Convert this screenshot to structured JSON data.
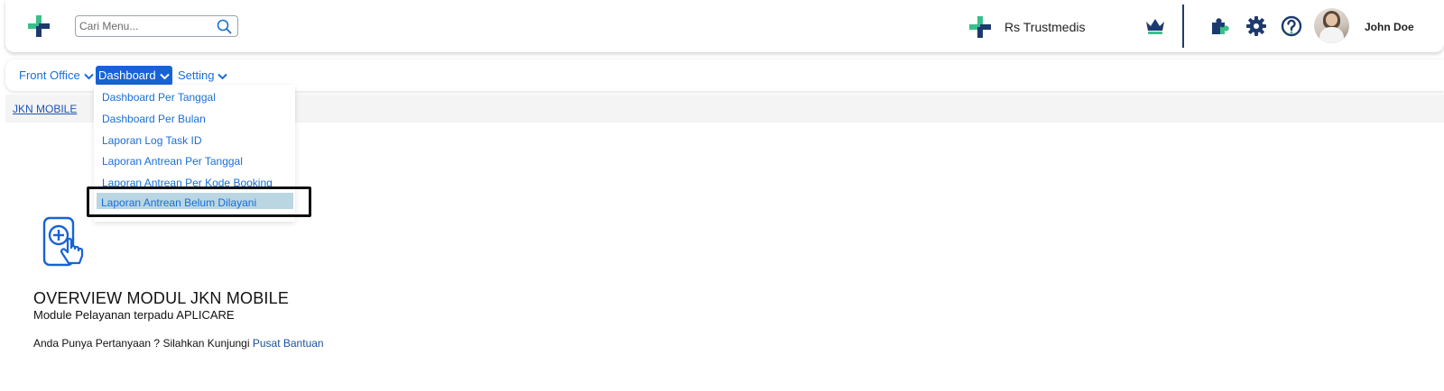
{
  "search": {
    "placeholder": "Cari Menu..."
  },
  "header": {
    "hospital_name": "Rs Trustmedis",
    "user_name": "John Doe"
  },
  "nav": {
    "items": [
      {
        "label": "Front Office"
      },
      {
        "label": "Dashboard"
      },
      {
        "label": "Setting"
      }
    ]
  },
  "dropdown": {
    "items": [
      {
        "label": "Dashboard Per Tanggal"
      },
      {
        "label": "Dashboard Per Bulan"
      },
      {
        "label": "Laporan Log Task ID"
      },
      {
        "label": "Laporan Antrean Per Tanggal"
      },
      {
        "label": "Laporan Antrean Per Kode Booking"
      },
      {
        "label": "Laporan Antrean Belum Dilayani"
      }
    ]
  },
  "breadcrumb": {
    "label": "JKN MOBILE"
  },
  "overview": {
    "title": "OVERVIEW MODUL JKN MOBILE",
    "subtitle": "Module Pelayanan terpadu APLICARE",
    "help_text": "Anda Punya Pertanyaan ? Silahkan Kunjungi",
    "help_link": "Pusat Bantuan"
  },
  "icons": {
    "logo": "plus-logo-icon",
    "search": "search-icon",
    "crown": "crown-icon",
    "puzzle": "puzzle-icon",
    "gear": "gear-icon",
    "help": "help-icon",
    "chevron": "chevron-down-icon",
    "jkn": "mobile-touch-icon"
  },
  "colors": {
    "primary_blue": "#1763d6",
    "link_blue": "#1a6ed8",
    "navy": "#1f3b6b",
    "logo_green": "#3bbf8a",
    "logo_navy": "#1d3a6e",
    "highlight": "#b9d6e2"
  }
}
